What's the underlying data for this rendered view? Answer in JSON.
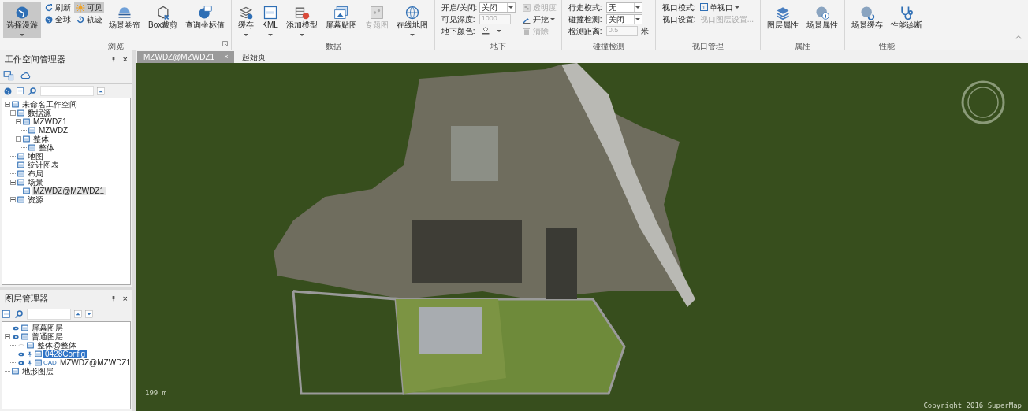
{
  "ribbon": {
    "groups": [
      {
        "label": "浏览",
        "launcher": true,
        "items": [
          {
            "kind": "large",
            "label": "选择漫游",
            "selected": true,
            "dropdown": true
          },
          {
            "kind": "stack",
            "buttons": [
              {
                "label": "刷新",
                "selected": false
              },
              {
                "label": "全球",
                "selected": false
              }
            ]
          },
          {
            "kind": "stack",
            "buttons": [
              {
                "label": "可见",
                "selected": true
              },
              {
                "label": "轨迹",
                "selected": false
              }
            ]
          },
          {
            "kind": "large",
            "label": "场景卷帘",
            "selected": false
          },
          {
            "kind": "large",
            "label": "Box裁剪",
            "selected": false
          },
          {
            "kind": "large",
            "label": "查询坐标值",
            "selected": false
          }
        ]
      },
      {
        "label": "数据",
        "items": [
          {
            "kind": "large",
            "label": "缓存",
            "dropdown": true
          },
          {
            "kind": "large",
            "label": "KML",
            "dropdown": true
          },
          {
            "kind": "large",
            "label": "添加模型",
            "dropdown": true
          },
          {
            "kind": "large",
            "label": "屏幕贴图"
          },
          {
            "kind": "large",
            "label": "专题图",
            "disabled": true
          },
          {
            "kind": "large",
            "label": "在线地图",
            "dropdown": true
          }
        ]
      },
      {
        "label": "地下",
        "items": [
          {
            "kind": "form",
            "rows": [
              {
                "label": "开启/关闭:",
                "kind": "select",
                "value": "关闭"
              },
              {
                "label": "可见深度:",
                "kind": "input",
                "placeholder": "1000",
                "disabled": true
              },
              {
                "label": "地下颜色:",
                "kind": "color"
              }
            ]
          },
          {
            "kind": "stack",
            "buttons": [
              {
                "label": "透明度",
                "disabled": true
              },
              {
                "label": "开挖",
                "disabled": false,
                "dropdown": true
              },
              {
                "label": "清除",
                "disabled": true
              }
            ]
          }
        ]
      },
      {
        "label": "碰撞检测",
        "items": [
          {
            "kind": "form",
            "rows": [
              {
                "label": "行走模式:",
                "kind": "select",
                "value": "无"
              },
              {
                "label": "碰撞检测:",
                "kind": "select",
                "value": "关闭"
              },
              {
                "label": "检测距离:",
                "kind": "input",
                "placeholder": "0.5",
                "disabled": true,
                "unit": "米"
              }
            ]
          }
        ]
      },
      {
        "label": "视口管理",
        "items": [
          {
            "kind": "form",
            "rows": [
              {
                "label": "视口模式:",
                "kind": "menu",
                "badge": "1",
                "value": "单视口"
              },
              {
                "label": "视口设置:",
                "kind": "menu",
                "value": "视口图层设置...",
                "disabled": true
              }
            ]
          }
        ]
      },
      {
        "label": "属性",
        "items": [
          {
            "kind": "large",
            "label": "图层属性"
          },
          {
            "kind": "large",
            "label": "场景属性"
          }
        ]
      },
      {
        "label": "性能",
        "items": [
          {
            "kind": "large",
            "label": "场景缓存"
          },
          {
            "kind": "large",
            "label": "性能诊断"
          }
        ]
      }
    ]
  },
  "workspace_panel": {
    "title": "工作空间管理器",
    "close": "×",
    "tree": [
      {
        "label": "未命名工作空间",
        "expanded": true,
        "children": [
          {
            "label": "数据源",
            "expanded": true,
            "children": [
              {
                "label": "MZWDZ1",
                "expanded": true,
                "children": [
                  {
                    "label": "MZWDZ"
                  }
                ]
              },
              {
                "label": "整体",
                "expanded": true,
                "children": [
                  {
                    "label": "整体"
                  }
                ]
              }
            ]
          },
          {
            "label": "地图"
          },
          {
            "label": "统计图表"
          },
          {
            "label": "布局"
          },
          {
            "label": "场景",
            "expanded": true,
            "children": [
              {
                "label": "MZWDZ@MZWDZ1",
                "selected": true
              }
            ]
          },
          {
            "label": "资源",
            "expanded": false
          }
        ]
      }
    ]
  },
  "layer_panel": {
    "title": "图层管理器",
    "close": "×",
    "tree": [
      {
        "label": "屏幕图层",
        "visible": true,
        "selected": false
      },
      {
        "label": "普通图层",
        "visible": true,
        "expanded": true,
        "selected": false,
        "children": [
          {
            "label": "整体@整体",
            "visible": false,
            "selected": false
          },
          {
            "label": "0428Config",
            "visible": true,
            "selected": true
          },
          {
            "label": "MZWDZ@MZWDZ1",
            "visible": true,
            "selected": false,
            "badge": "CAD"
          }
        ]
      },
      {
        "label": "地形图层",
        "selected": false
      }
    ]
  },
  "tabs": [
    {
      "label": "MZWDZ@MZWDZ1",
      "selected": true,
      "close": "×"
    },
    {
      "label": "起始页",
      "selected": false
    }
  ],
  "scene": {
    "scale": "199 m",
    "copyright": "Copyright 2016 SuperMap"
  }
}
